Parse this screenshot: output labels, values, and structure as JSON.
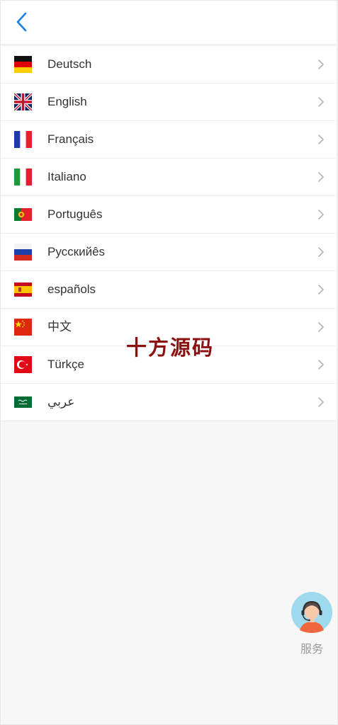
{
  "header": {
    "back_icon": "chevron-left-icon",
    "accent": "#1a7fe6"
  },
  "languages": [
    {
      "label": "Deutsch",
      "flag": "germany"
    },
    {
      "label": "English",
      "flag": "united-kingdom"
    },
    {
      "label": "Français",
      "flag": "france"
    },
    {
      "label": "Italiano",
      "flag": "italy"
    },
    {
      "label": "Português",
      "flag": "portugal"
    },
    {
      "label": "Русскийês",
      "flag": "russia"
    },
    {
      "label": "españols",
      "flag": "spain"
    },
    {
      "label": "中文",
      "flag": "china"
    },
    {
      "label": "Türkçe",
      "flag": "turkey"
    },
    {
      "label": "عربي",
      "flag": "saudi-arabia"
    }
  ],
  "watermark": {
    "text": "十方源码",
    "color": "#8b1010"
  },
  "service": {
    "label": "服务",
    "icon": "customer-service-agent-icon"
  }
}
